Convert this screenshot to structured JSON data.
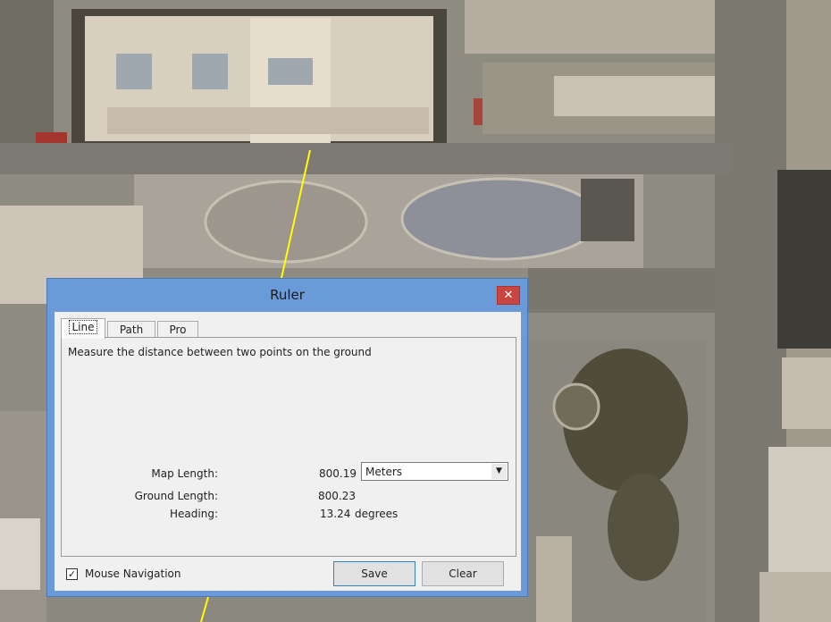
{
  "map": {
    "measure_line_color": "#ffff00"
  },
  "dialog": {
    "title": "Ruler",
    "close_label": "✕",
    "tabs": [
      {
        "label": "Line",
        "active": true
      },
      {
        "label": "Path",
        "active": false
      },
      {
        "label": "Pro",
        "active": false
      }
    ],
    "description": "Measure the distance between two points on the ground",
    "map_length_label": "Map Length:",
    "map_length_value": "800.19",
    "unit_selected": "Meters",
    "ground_length_label": "Ground Length:",
    "ground_length_value": "800.23",
    "heading_label": "Heading:",
    "heading_value": "13.24",
    "heading_unit": "degrees",
    "mouse_navigation_label": "Mouse Navigation",
    "mouse_navigation_checked": true,
    "checkmark": "✓",
    "save_label": "Save",
    "clear_label": "Clear",
    "dropdown_arrow": "▼"
  },
  "colors": {
    "title_bar": "#6a9ad8",
    "close_button": "#c8463f"
  }
}
